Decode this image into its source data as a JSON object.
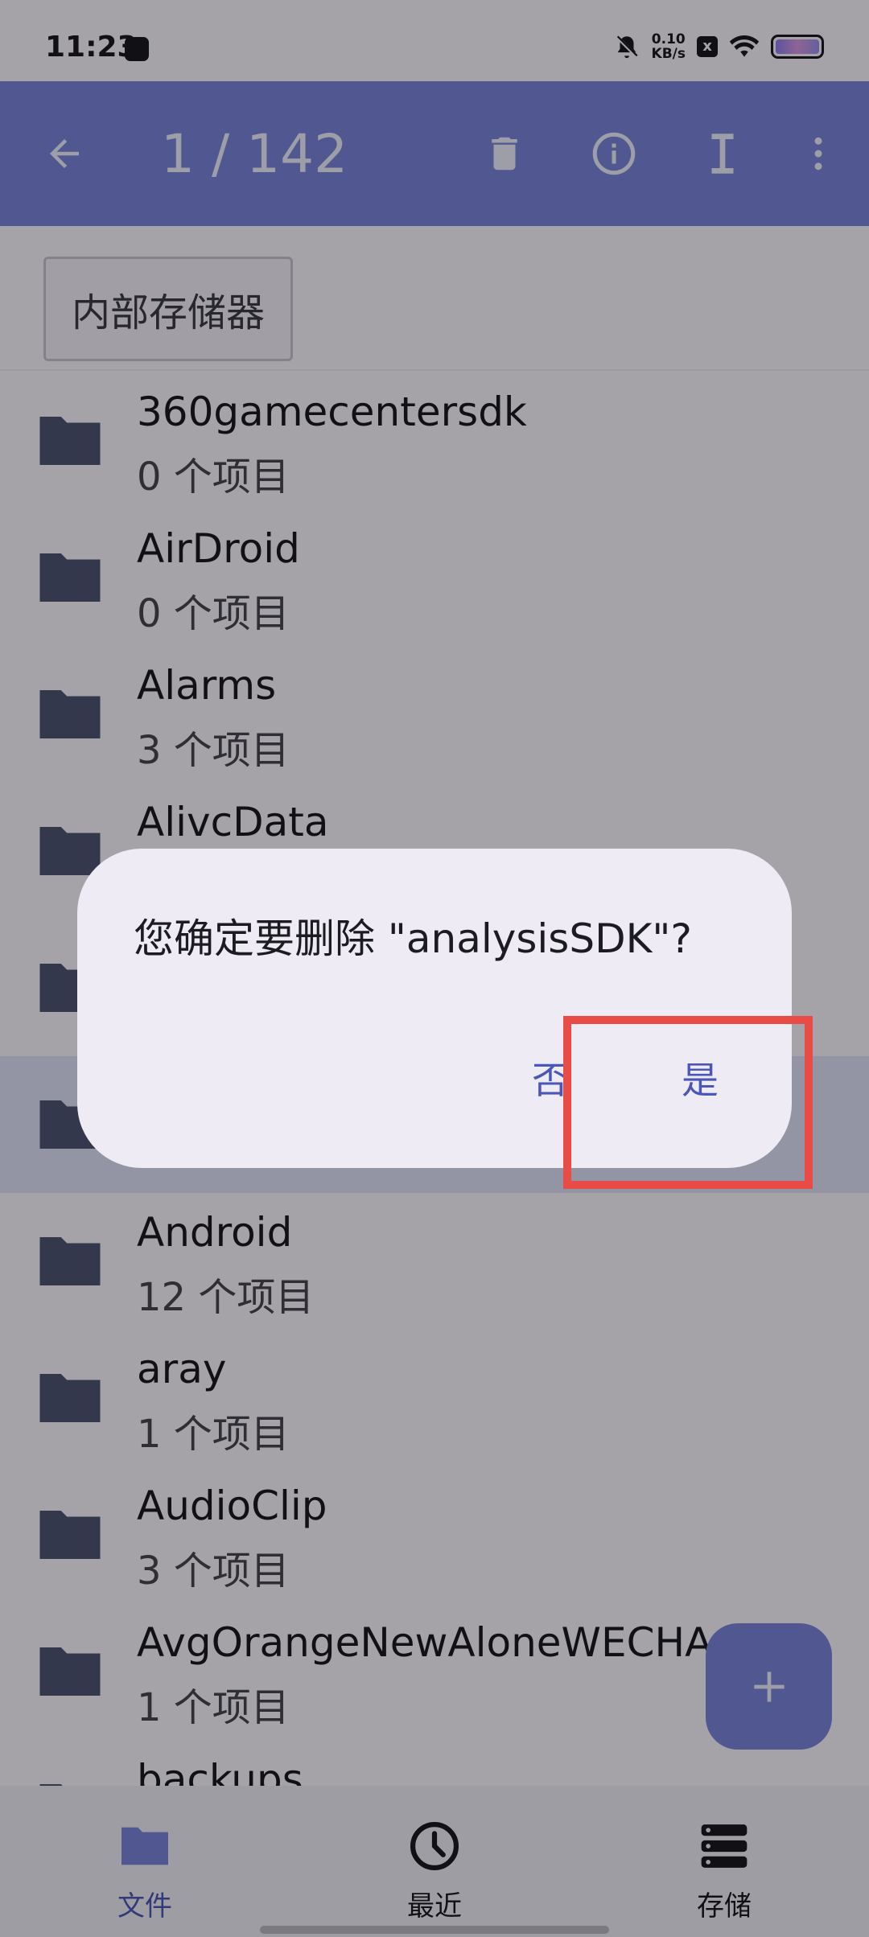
{
  "status_bar": {
    "time": "11:23",
    "speed_value": "0.10",
    "speed_unit": "KB/s",
    "sim_label": "x"
  },
  "toolbar": {
    "title": "1 / 142",
    "icons": [
      "back-arrow-icon",
      "trash-icon",
      "info-icon",
      "text-cursor-icon",
      "more-vert-icon"
    ]
  },
  "breadcrumb": {
    "label": "内部存储器"
  },
  "files": [
    {
      "name": "360gamecentersdk",
      "meta": "0 个项目"
    },
    {
      "name": "AirDroid",
      "meta": "0 个项目"
    },
    {
      "name": "Alarms",
      "meta": "3 个项目"
    },
    {
      "name": "AlivcData",
      "meta": ""
    },
    {
      "name": "",
      "meta": ""
    },
    {
      "name": "",
      "meta": ""
    },
    {
      "name": "Android",
      "meta": "12 个项目"
    },
    {
      "name": "aray",
      "meta": "1 个项目"
    },
    {
      "name": "AudioClip",
      "meta": "3 个项目"
    },
    {
      "name": "AvgOrangeNewAloneWECHA",
      "meta": "1 个项目"
    },
    {
      "name": "backups",
      "meta": ""
    }
  ],
  "fab": {
    "icon": "plus-icon"
  },
  "bottom_nav": {
    "items": [
      {
        "label": "文件",
        "icon": "folder-icon",
        "active": true
      },
      {
        "label": "最近",
        "icon": "clock-icon",
        "active": false
      },
      {
        "label": "存储",
        "icon": "storage-icon",
        "active": false
      }
    ]
  },
  "dialog": {
    "message": "您确定要删除 \"analysisSDK\"?",
    "no_label": "否",
    "yes_label": "是"
  },
  "colors": {
    "primary": "#7b86dc",
    "accent_text": "#4b57b8",
    "highlight_box": "#e94b47"
  }
}
